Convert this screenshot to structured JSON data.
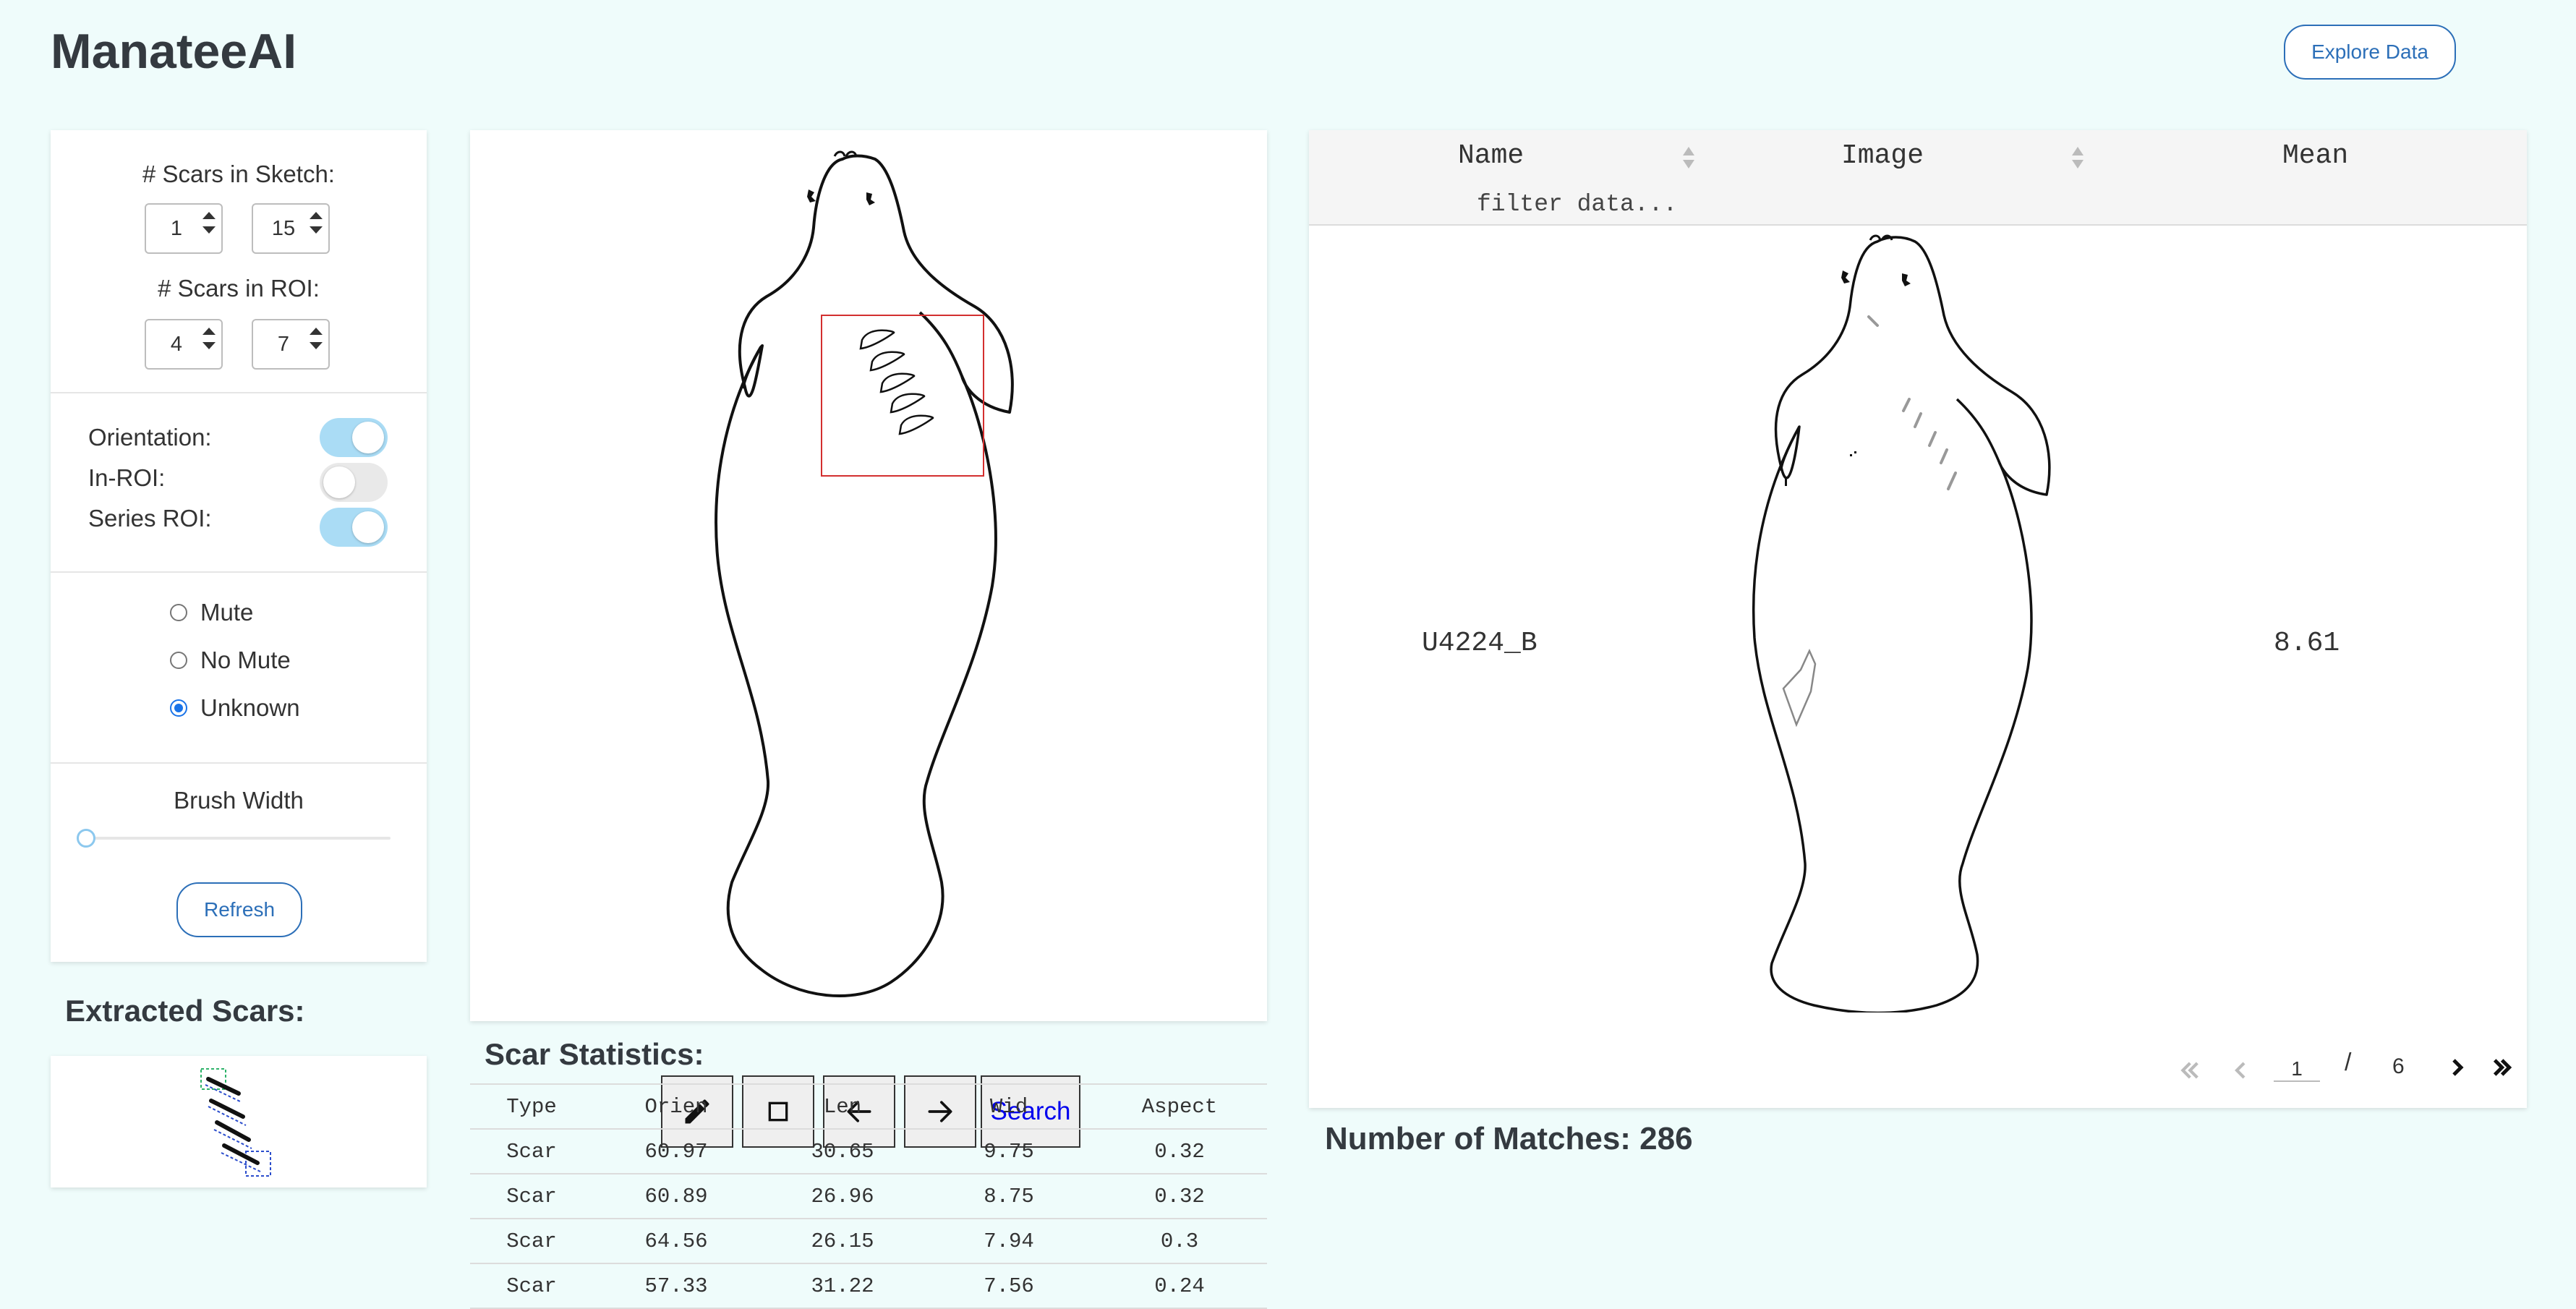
{
  "app": {
    "title": "ManateeAI",
    "explore_label": "Explore Data"
  },
  "sidebar": {
    "scars_in_sketch_label": "# Scars in Sketch:",
    "scars_in_sketch_min": "1",
    "scars_in_sketch_max": "15",
    "scars_in_roi_label": "# Scars in ROI:",
    "scars_in_roi_min": "4",
    "scars_in_roi_max": "7",
    "toggles": [
      {
        "label": "Orientation:",
        "on": true
      },
      {
        "label": "In-ROI:",
        "on": false
      },
      {
        "label": "Series ROI:",
        "on": true
      }
    ],
    "mute_options": [
      {
        "label": "Mute",
        "checked": false
      },
      {
        "label": "No Mute",
        "checked": false
      },
      {
        "label": "Unknown",
        "checked": true
      }
    ],
    "brush_width_label": "Brush Width",
    "brush_width_value": 0,
    "refresh_label": "Refresh"
  },
  "extracted": {
    "title": "Extracted Scars:"
  },
  "canvas": {
    "tools": [
      "pencil-icon",
      "square-icon",
      "arrow-left-icon",
      "arrow-right-icon"
    ],
    "search_label": "Search"
  },
  "stats": {
    "title": "Scar Statistics:",
    "columns": [
      "Type",
      "Orien",
      "Len",
      "Wid",
      "Aspect"
    ],
    "rows": [
      [
        "Scar",
        "60.97",
        "30.65",
        "9.75",
        "0.32"
      ],
      [
        "Scar",
        "60.89",
        "26.96",
        "8.75",
        "0.32"
      ],
      [
        "Scar",
        "64.56",
        "26.15",
        "7.94",
        "0.3"
      ],
      [
        "Scar",
        "57.33",
        "31.22",
        "7.56",
        "0.24"
      ]
    ]
  },
  "results": {
    "columns": [
      "Name",
      "Image",
      "Mean"
    ],
    "filter_placeholder": "filter data...",
    "row": {
      "name": "U4224_B",
      "mean": "8.61"
    },
    "page_current": "1",
    "page_sep": "/",
    "page_total": "6"
  },
  "matches_label": "Number of Matches: 286",
  "colors": {
    "accent": "#2c6fb8",
    "toggle_on": "#aadcf5",
    "roi_box": "#d32f2f",
    "background": "#effcfb"
  }
}
